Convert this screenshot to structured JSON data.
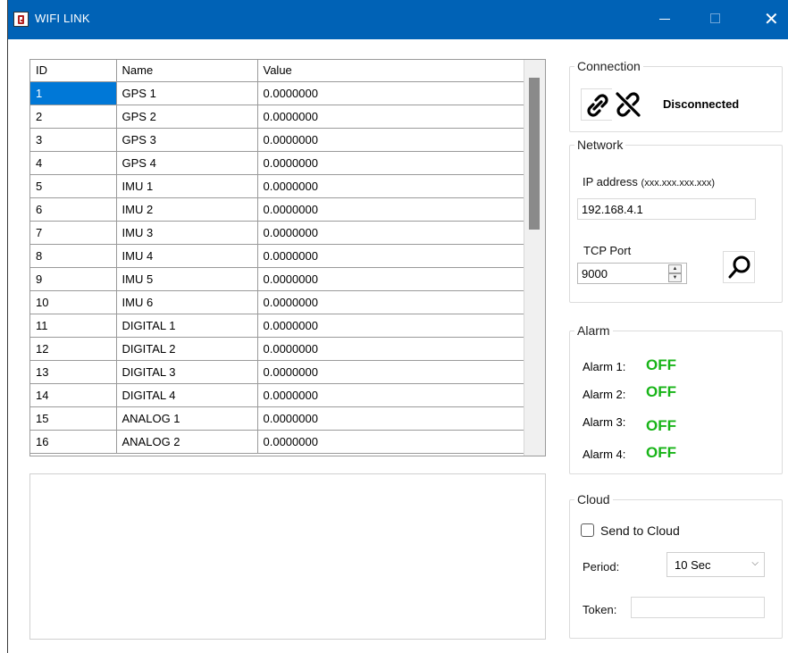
{
  "window": {
    "title": "WIFI LINK",
    "controls": {
      "minimize": "—",
      "maximize": "□",
      "close": "✕"
    }
  },
  "grid": {
    "columns": [
      "ID",
      "Name",
      "Value"
    ],
    "rows": [
      {
        "id": "1",
        "name": "GPS 1",
        "value": "0.0000000"
      },
      {
        "id": "2",
        "name": "GPS 2",
        "value": "0.0000000"
      },
      {
        "id": "3",
        "name": "GPS 3",
        "value": "0.0000000"
      },
      {
        "id": "4",
        "name": "GPS 4",
        "value": "0.0000000"
      },
      {
        "id": "5",
        "name": "IMU 1",
        "value": "0.0000000"
      },
      {
        "id": "6",
        "name": "IMU 2",
        "value": "0.0000000"
      },
      {
        "id": "7",
        "name": "IMU 3",
        "value": "0.0000000"
      },
      {
        "id": "8",
        "name": "IMU 4",
        "value": "0.0000000"
      },
      {
        "id": "9",
        "name": "IMU 5",
        "value": "0.0000000"
      },
      {
        "id": "10",
        "name": "IMU 6",
        "value": "0.0000000"
      },
      {
        "id": "11",
        "name": "DIGITAL 1",
        "value": "0.0000000"
      },
      {
        "id": "12",
        "name": "DIGITAL 2",
        "value": "0.0000000"
      },
      {
        "id": "13",
        "name": "DIGITAL 3",
        "value": "0.0000000"
      },
      {
        "id": "14",
        "name": "DIGITAL 4",
        "value": "0.0000000"
      },
      {
        "id": "15",
        "name": "ANALOG 1",
        "value": "0.0000000"
      },
      {
        "id": "16",
        "name": "ANALOG 2",
        "value": "0.0000000"
      }
    ],
    "selected_cell": "1"
  },
  "connection": {
    "title": "Connection",
    "connect_icon": "link-icon",
    "disconnect_icon": "unlink-icon",
    "status": "Disconnected"
  },
  "network": {
    "title": "Network",
    "ip_label": "IP address",
    "ip_hint": "(xxx.xxx.xxx.xxx)",
    "ip_value": "192.168.4.1",
    "port_label": "TCP Port",
    "port_value": "9000",
    "search_icon": "search-icon"
  },
  "alarm": {
    "title": "Alarm",
    "items": [
      {
        "label": "Alarm 1:",
        "state": "OFF"
      },
      {
        "label": "Alarm 2:",
        "state": "OFF"
      },
      {
        "label": "Alarm 3:",
        "state": "OFF"
      },
      {
        "label": "Alarm 4:",
        "state": "OFF"
      }
    ],
    "off_color": "#18b418"
  },
  "cloud": {
    "title": "Cloud",
    "send_label": "Send to Cloud",
    "send_checked": false,
    "period_label": "Period:",
    "period_value": "10 Sec",
    "token_label": "Token:",
    "token_value": ""
  },
  "colors": {
    "titlebar": "#0062b6",
    "selection": "#0078d7"
  }
}
